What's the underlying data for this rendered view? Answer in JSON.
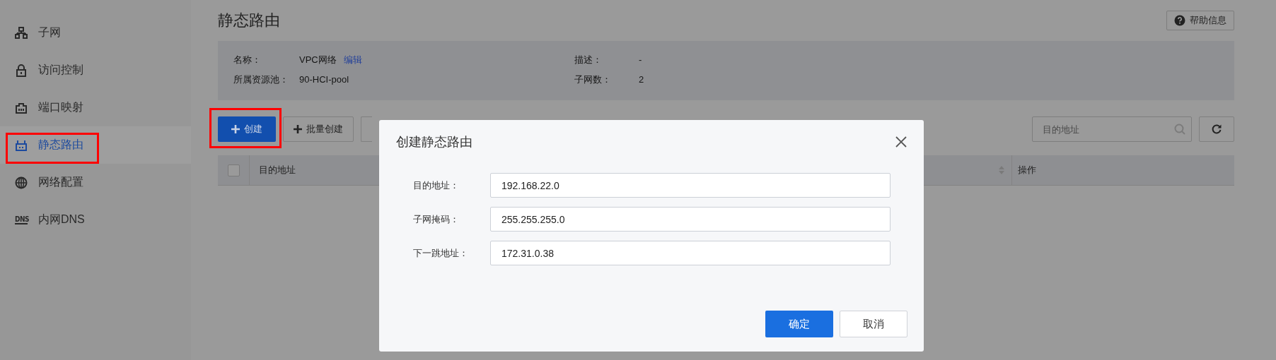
{
  "sidebar": {
    "items": [
      {
        "label": "子网",
        "kind": "subnet",
        "selected": false,
        "highlighted": false
      },
      {
        "label": "访问控制",
        "kind": "lock",
        "selected": false,
        "highlighted": false
      },
      {
        "label": "端口映射",
        "kind": "port",
        "selected": false,
        "highlighted": false
      },
      {
        "label": "静态路由",
        "kind": "route",
        "selected": true,
        "highlighted": true
      },
      {
        "label": "网络配置",
        "kind": "globe",
        "selected": false,
        "highlighted": false
      },
      {
        "label": "内网DNS",
        "kind": "dns",
        "icon_text": "DNS",
        "selected": false,
        "highlighted": false
      }
    ]
  },
  "page": {
    "title": "静态路由",
    "help_button": "帮助信息",
    "info": {
      "fields": [
        {
          "label": "名称：",
          "value": "VPC网络",
          "link": "编辑"
        },
        {
          "label": "描述：",
          "value": "-"
        },
        {
          "label": "所属资源池：",
          "value": "90-HCI-pool"
        },
        {
          "label": "子网数：",
          "value": "2"
        }
      ]
    },
    "toolbar": {
      "create_button": {
        "label": "创建",
        "highlighted": true
      },
      "batch_create_button": "批量创建",
      "search": {
        "placeholder": "目的地址"
      }
    },
    "table": {
      "select_all": {
        "checked": false
      },
      "columns": [
        {
          "label": "目的地址"
        },
        {
          "label": "操作"
        }
      ]
    }
  },
  "dialog": {
    "title": "创建静态路由",
    "fields": [
      {
        "label": "目的地址：",
        "value": "192.168.22.0"
      },
      {
        "label": "子网掩码：",
        "value": "255.255.255.0"
      },
      {
        "label": "下一跳地址：",
        "value": "172.31.0.38"
      }
    ],
    "buttons": [
      {
        "label": "确定",
        "kind": "primary"
      },
      {
        "label": "取消",
        "kind": "default"
      }
    ]
  }
}
